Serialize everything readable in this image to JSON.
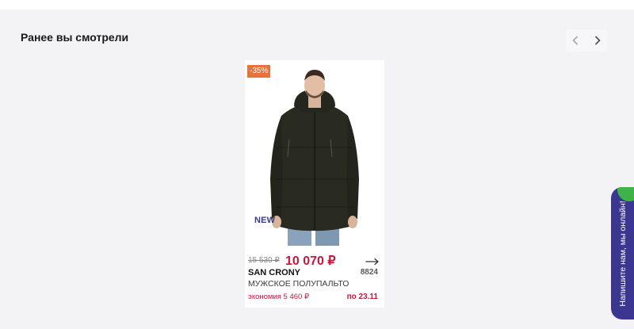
{
  "section": {
    "title": "Ранее вы смотрели"
  },
  "carousel": {
    "prev_icon": "chevron-left-icon",
    "next_icon": "chevron-right-icon"
  },
  "product": {
    "discount": "-35%",
    "badge_new": "NEW",
    "old_price": "15 530 ₽",
    "price": "10 070 ₽",
    "brand": "SAN CRONY",
    "article": "8824",
    "name": "МУЖСКОЕ ПОЛУПАЛЬТО",
    "savings": "экономия 5 460 ₽",
    "until": "по 23.11",
    "arrow_icon": "arrow-right-icon",
    "image": "man-in-dark-parka"
  },
  "chat": {
    "label": "Напишите нам, мы онлайн!"
  },
  "colors": {
    "accent_price": "#c8163a",
    "badge": "#e8733a",
    "chat_bg": "#3b3791",
    "chat_dot": "#3fb24a",
    "page_bg": "#f3f3f6"
  }
}
